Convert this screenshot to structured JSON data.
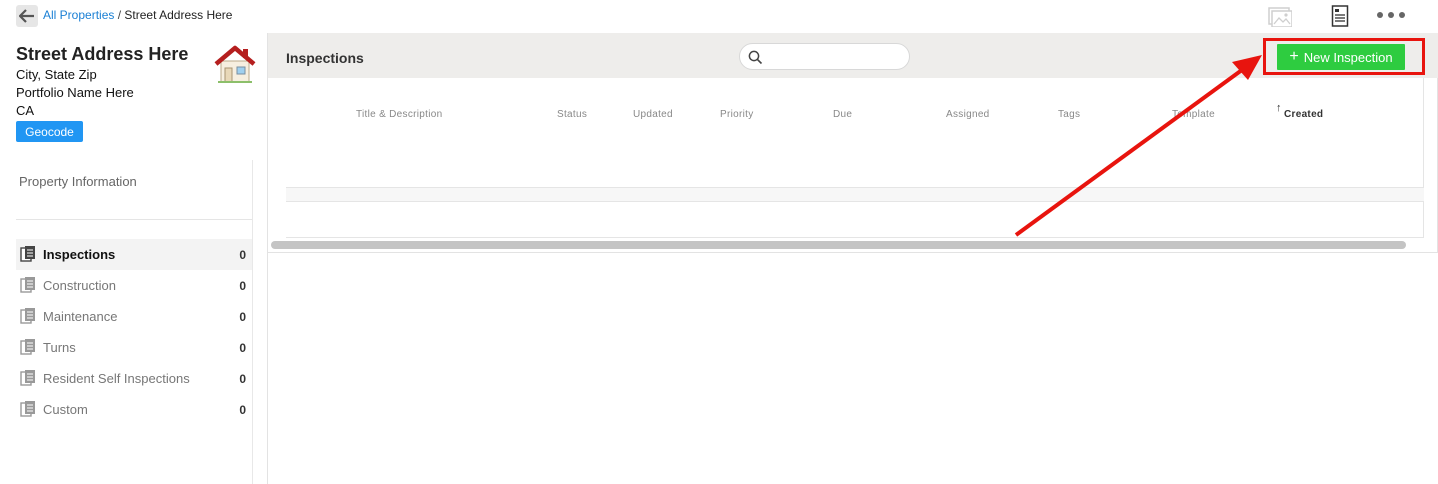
{
  "breadcrumb": {
    "parent": "All Properties",
    "separator": "/",
    "current": "Street Address Here"
  },
  "property": {
    "title": "Street Address Here",
    "city_line": "City, State Zip",
    "portfolio": "Portfolio Name Here",
    "state": "CA",
    "geocode_label": "Geocode"
  },
  "sidebar": {
    "property_info_label": "Property Information",
    "items": [
      {
        "label": "Inspections",
        "count": "0",
        "active": true
      },
      {
        "label": "Construction",
        "count": "0"
      },
      {
        "label": "Maintenance",
        "count": "0"
      },
      {
        "label": "Turns",
        "count": "0"
      },
      {
        "label": "Resident Self Inspections",
        "count": "0"
      },
      {
        "label": "Custom",
        "count": "0"
      }
    ]
  },
  "main": {
    "title": "Inspections",
    "search_value": "",
    "new_button_label": "New Inspection",
    "columns": [
      "Title & Description",
      "Status",
      "Updated",
      "Priority",
      "Due",
      "Assigned",
      "Tags",
      "Template",
      "Created"
    ],
    "sorted_column": "Created",
    "sort_indicator": "↑"
  },
  "colors": {
    "accent_blue": "#2196f3",
    "link_blue": "#1a7fd4",
    "new_button_green": "#2ecc40",
    "annotation_red": "#e8140e",
    "header_bg": "#eeedeb"
  },
  "icons": {
    "back": "arrow-left-icon",
    "photo": "image-icon",
    "report": "document-list-icon",
    "more": "more-horizontal-icon",
    "house": "house-icon",
    "search": "search-icon",
    "nav": "documents-icon",
    "plus": "plus-icon"
  }
}
